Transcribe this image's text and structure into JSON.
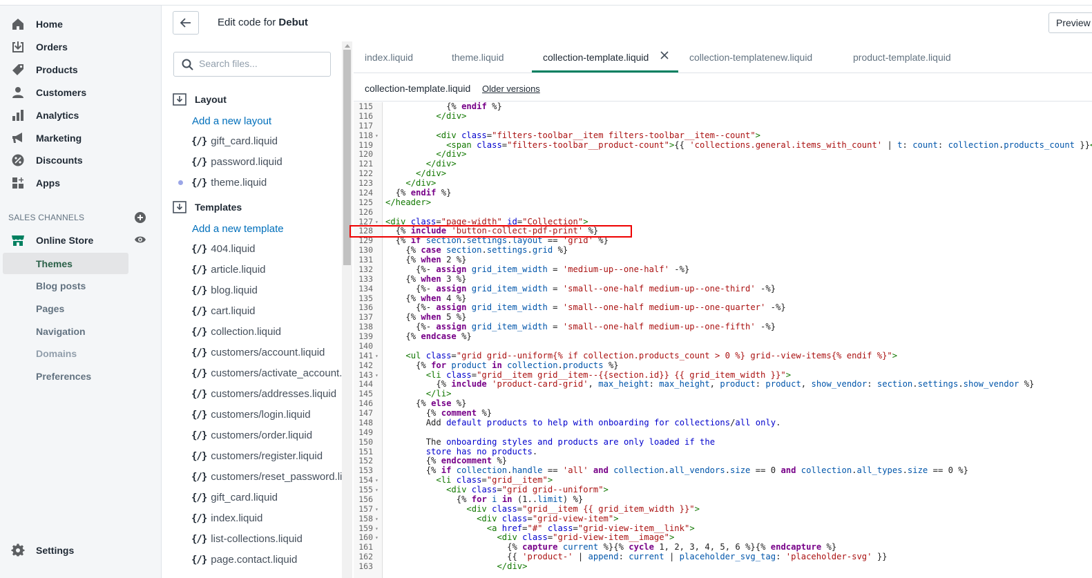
{
  "nav": {
    "main": [
      {
        "label": "Home",
        "icon": "home-icon"
      },
      {
        "label": "Orders",
        "icon": "orders-icon"
      },
      {
        "label": "Products",
        "icon": "tag-icon"
      },
      {
        "label": "Customers",
        "icon": "person-icon"
      },
      {
        "label": "Analytics",
        "icon": "bar-chart-icon"
      },
      {
        "label": "Marketing",
        "icon": "megaphone-icon"
      },
      {
        "label": "Discounts",
        "icon": "discount-icon"
      },
      {
        "label": "Apps",
        "icon": "apps-icon"
      }
    ],
    "sales_channels_label": "SALES CHANNELS",
    "online_store": "Online Store",
    "online_store_sub": [
      "Themes",
      "Blog posts",
      "Pages",
      "Navigation",
      "Domains",
      "Preferences"
    ],
    "settings": "Settings"
  },
  "header": {
    "title_prefix": "Edit code for ",
    "theme_name": "Debut",
    "preview_label": "Preview"
  },
  "files": {
    "search_placeholder": "Search files...",
    "layout_folder": "Layout",
    "add_layout": "Add a new layout",
    "layout_files": [
      "gift_card.liquid",
      "password.liquid",
      "theme.liquid"
    ],
    "templates_folder": "Templates",
    "add_template": "Add a new template",
    "template_files": [
      "404.liquid",
      "article.liquid",
      "blog.liquid",
      "cart.liquid",
      "collection.liquid",
      "customers/account.liquid",
      "customers/activate_account.liquid",
      "customers/addresses.liquid",
      "customers/login.liquid",
      "customers/order.liquid",
      "customers/register.liquid",
      "customers/reset_password.liquid",
      "gift_card.liquid",
      "index.liquid",
      "list-collections.liquid",
      "page.contact.liquid"
    ],
    "bracket_glyph": "{/}"
  },
  "tabs": [
    "index.liquid",
    "theme.liquid",
    "collection-template.liquid",
    "collection-templatenew.liquid",
    "product-template.liquid"
  ],
  "editor": {
    "file_title": "collection-template.liquid",
    "older_versions": "Older versions"
  },
  "code": [
    {
      "n": "115",
      "f": "",
      "t": "            {% endif %}"
    },
    {
      "n": "116",
      "f": "",
      "t": "          </div>"
    },
    {
      "n": "117",
      "f": "",
      "t": ""
    },
    {
      "n": "118",
      "f": "▾",
      "t": "          <div class=\"filters-toolbar__item filters-toolbar__item--count\">"
    },
    {
      "n": "119",
      "f": "",
      "t": "            <span class=\"filters-toolbar__product-count\">{{ 'collections.general.items_with_count' | t: count: collection.products_count }}</span>"
    },
    {
      "n": "120",
      "f": "",
      "t": "          </div>"
    },
    {
      "n": "121",
      "f": "",
      "t": "        </div>"
    },
    {
      "n": "122",
      "f": "",
      "t": "      </div>"
    },
    {
      "n": "123",
      "f": "",
      "t": "    </div>"
    },
    {
      "n": "124",
      "f": "",
      "t": "  {% endif %}"
    },
    {
      "n": "125",
      "f": "",
      "t": "</header>"
    },
    {
      "n": "126",
      "f": "",
      "t": ""
    },
    {
      "n": "127",
      "f": "▾",
      "t": "<div class=\"page-width\" id=\"Collection\">"
    },
    {
      "n": "128",
      "f": "",
      "t": "  {% include 'button-collect-pdf-print' %}"
    },
    {
      "n": "129",
      "f": "",
      "t": "  {% if section.settings.layout == 'grid' %}"
    },
    {
      "n": "130",
      "f": "",
      "t": "    {% case section.settings.grid %}"
    },
    {
      "n": "131",
      "f": "",
      "t": "    {% when 2 %}"
    },
    {
      "n": "132",
      "f": "",
      "t": "      {%- assign grid_item_width = 'medium-up--one-half' -%}"
    },
    {
      "n": "133",
      "f": "",
      "t": "    {% when 3 %}"
    },
    {
      "n": "134",
      "f": "",
      "t": "      {%- assign grid_item_width = 'small--one-half medium-up--one-third' -%}"
    },
    {
      "n": "135",
      "f": "",
      "t": "    {% when 4 %}"
    },
    {
      "n": "136",
      "f": "",
      "t": "      {%- assign grid_item_width = 'small--one-half medium-up--one-quarter' -%}"
    },
    {
      "n": "137",
      "f": "",
      "t": "    {% when 5 %}"
    },
    {
      "n": "138",
      "f": "",
      "t": "      {%- assign grid_item_width = 'small--one-half medium-up--one-fifth' -%}"
    },
    {
      "n": "139",
      "f": "",
      "t": "    {% endcase %}"
    },
    {
      "n": "140",
      "f": "",
      "t": ""
    },
    {
      "n": "141",
      "f": "▾",
      "t": "    <ul class=\"grid grid--uniform{% if collection.products_count > 0 %} grid--view-items{% endif %}\">"
    },
    {
      "n": "142",
      "f": "",
      "t": "      {% for product in collection.products %}"
    },
    {
      "n": "143",
      "f": "▾",
      "t": "        <li class=\"grid__item grid__item--{{section.id}} {{ grid_item_width }}\">"
    },
    {
      "n": "144",
      "f": "",
      "t": "          {% include 'product-card-grid', max_height: max_height, product: product, show_vendor: section.settings.show_vendor %}"
    },
    {
      "n": "145",
      "f": "",
      "t": "        </li>"
    },
    {
      "n": "146",
      "f": "",
      "t": "      {% else %}"
    },
    {
      "n": "147",
      "f": "",
      "t": "        {% comment %}"
    },
    {
      "n": "148",
      "f": "",
      "t": "        Add default products to help with onboarding for collections/all only."
    },
    {
      "n": "149",
      "f": "",
      "t": ""
    },
    {
      "n": "150",
      "f": "",
      "t": "        The onboarding styles and products are only loaded if the"
    },
    {
      "n": "151",
      "f": "",
      "t": "        store has no products."
    },
    {
      "n": "152",
      "f": "",
      "t": "        {% endcomment %}"
    },
    {
      "n": "153",
      "f": "",
      "t": "        {% if collection.handle == 'all' and collection.all_vendors.size == 0 and collection.all_types.size == 0 %}"
    },
    {
      "n": "154",
      "f": "▾",
      "t": "          <li class=\"grid__item\">"
    },
    {
      "n": "155",
      "f": "▾",
      "t": "            <div class=\"grid grid--uniform\">"
    },
    {
      "n": "156",
      "f": "",
      "t": "              {% for i in (1..limit) %}"
    },
    {
      "n": "157",
      "f": "▾",
      "t": "                <div class=\"grid__item {{ grid_item_width }}\">"
    },
    {
      "n": "158",
      "f": "▾",
      "t": "                  <div class=\"grid-view-item\">"
    },
    {
      "n": "159",
      "f": "▾",
      "t": "                    <a href=\"#\" class=\"grid-view-item__link\">"
    },
    {
      "n": "160",
      "f": "▾",
      "t": "                      <div class=\"grid-view-item__image\">"
    },
    {
      "n": "161",
      "f": "",
      "t": "                        {% capture current %}{% cycle 1, 2, 3, 4, 5, 6 %}{% endcapture %}"
    },
    {
      "n": "162",
      "f": "",
      "t": "                        {{ 'product-' | append: current | placeholder_svg_tag: 'placeholder-svg' }}"
    },
    {
      "n": "163",
      "f": "",
      "t": "                      </div>"
    }
  ]
}
